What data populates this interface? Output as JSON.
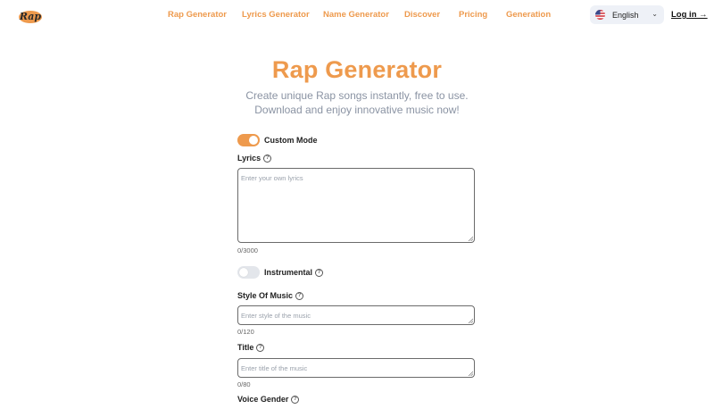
{
  "header": {
    "nav": [
      "Rap Generator",
      "Lyrics Generator",
      "Name Generator",
      "Discover",
      "Pricing",
      "Generation"
    ],
    "language": "English",
    "login": "Log in →"
  },
  "hero": {
    "title": "Rap Generator",
    "subtitle_line1": "Create unique Rap songs instantly, free to use.",
    "subtitle_line2": "Download and enjoy innovative music now!"
  },
  "form": {
    "custom_mode": {
      "label": "Custom Mode",
      "on": true
    },
    "lyrics": {
      "label": "Lyrics",
      "placeholder": "Enter your own lyrics",
      "counter": "0/3000"
    },
    "instrumental": {
      "label": "Instrumental",
      "on": false
    },
    "style": {
      "label": "Style Of Music",
      "placeholder": "Enter style of the music",
      "counter": "0/120"
    },
    "title": {
      "label": "Title",
      "placeholder": "Enter title of the music",
      "counter": "0/80"
    },
    "voice_gender": {
      "label": "Voice Gender"
    }
  },
  "colors": {
    "accent": "#EE9A4D",
    "subtitle": "#8A93A3"
  }
}
